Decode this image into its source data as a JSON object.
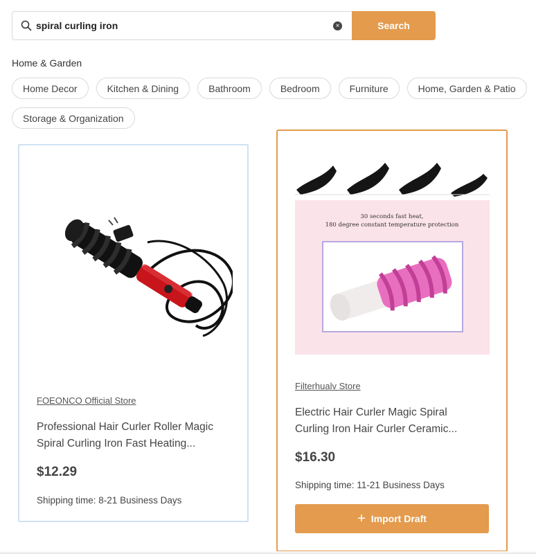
{
  "search": {
    "value": "spiral curling iron",
    "clear_icon": "close-circle-icon",
    "button_label": "Search"
  },
  "category": {
    "title": "Home & Garden",
    "chips": [
      "Home Decor",
      "Kitchen & Dining",
      "Bathroom",
      "Bedroom",
      "Furniture",
      "Home, Garden & Patio",
      "Storage & Organization"
    ]
  },
  "products": [
    {
      "store": "FOEONCO Official Store",
      "title_line1": "Professional Hair Curler Roller Magic",
      "title_line2": "Spiral Curling Iron Fast Heating...",
      "price": "$12.29",
      "shipping": "Shipping time: 8-21 Business Days",
      "image_icon": "spiral-curling-iron-red-image"
    },
    {
      "store": "Filterhualv Store",
      "title_line1": "Electric Hair Curler Magic Spiral",
      "title_line2": "Curling Iron Hair Curler Ceramic...",
      "price": "$16.30",
      "shipping": "Shipping time: 11-21 Business Days",
      "image_caption_line1": "30 seconds fast heat,",
      "image_caption_line2": "180 degree constant temperature protection",
      "image_icon": "spiral-curling-iron-pink-image",
      "import_label": "Import Draft"
    }
  ],
  "colors": {
    "accent": "#e49b4d",
    "card_border_default": "#cfe1f3",
    "card_border_selected": "#e49b4d"
  }
}
